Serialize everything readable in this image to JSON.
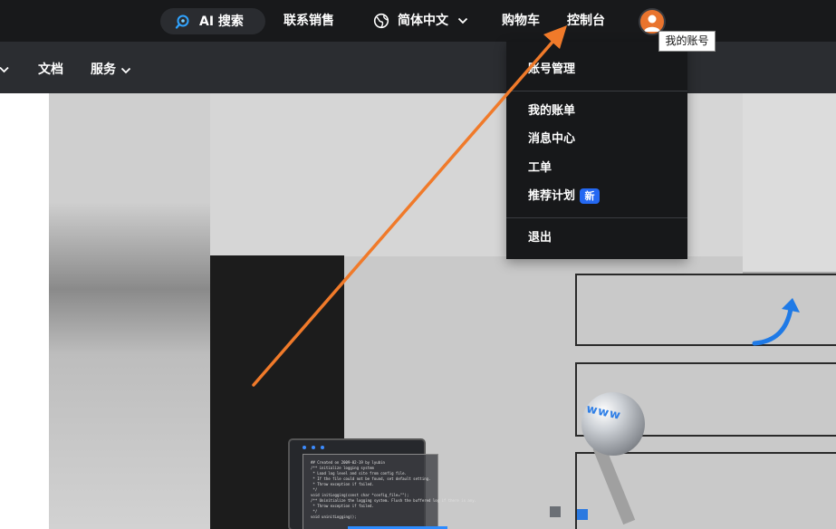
{
  "topbar": {
    "ai_search_label": "AI 搜索",
    "contact_sales_label": "联系销售",
    "language_label": "简体中文",
    "cart_label": "购物车",
    "console_label": "控制台"
  },
  "subnav": {
    "docs_label": "文档",
    "services_label": "服务"
  },
  "account_menu": {
    "items": [
      {
        "label": "账号管理"
      },
      {
        "label": "我的账单"
      },
      {
        "label": "消息中心"
      },
      {
        "label": "工单"
      },
      {
        "label": "推荐计划",
        "badge": "新"
      },
      {
        "label": "退出"
      }
    ]
  },
  "tooltip": {
    "text": "我的账号"
  },
  "hero": {
    "code_lines": "## Created on 2009-02-19 by lyubin\n/** initialize logging system\n * Load log level and site from config file.\n * If the file could not be found, set default setting.\n * Throw exception if failed.\n */\nvoid initLogging(const char *config_file=\"\");\n/** Uninitialize the logging system. Flush the buffered log if there is any.\n * Throw exception if failed.\n */\nvoid uninitLogging();",
    "globe_text": "www"
  },
  "colors": {
    "topbar_bg": "#18191b",
    "subbar_bg": "#2b2d31",
    "menu_bg": "#17181a",
    "badge_blue": "#2468f2",
    "annotation_orange": "#f07a2a",
    "avatar_orange": "#e9742e"
  },
  "icons": {
    "ai_search": "ai-search-icon",
    "language": "globe-icon",
    "avatar": "user-avatar-icon"
  }
}
